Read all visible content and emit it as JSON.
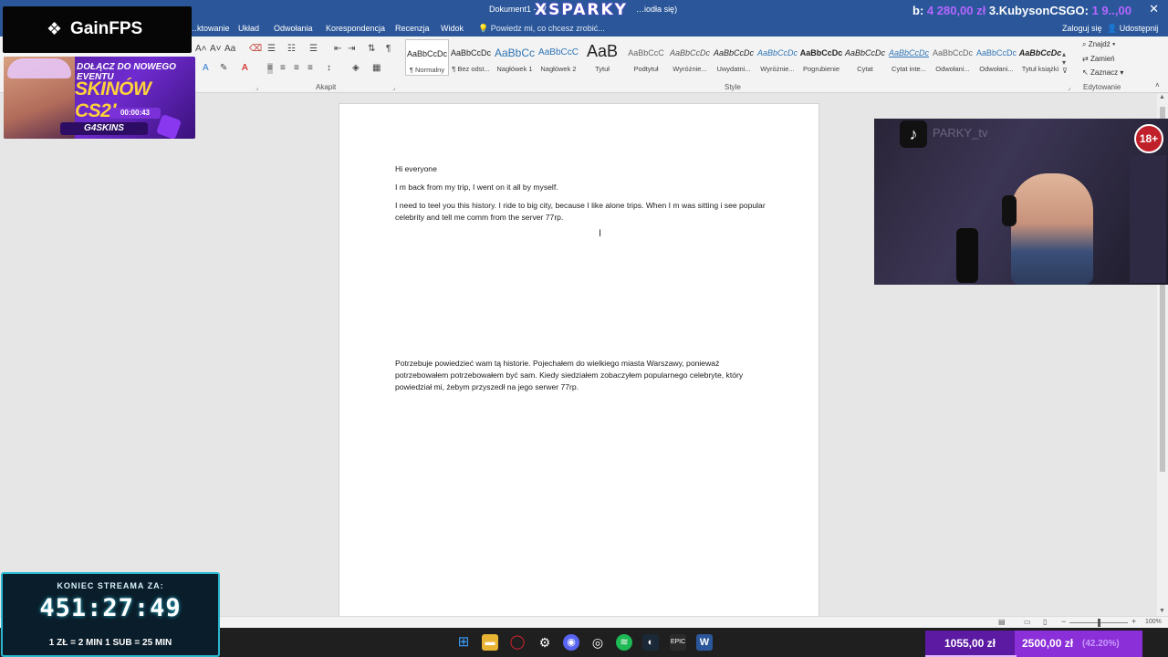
{
  "window": {
    "doc_title": "Dokument1 - W",
    "doc_title_tail": "…iodła się)",
    "watermark": "XSPARKY",
    "close_glyph": "✕"
  },
  "menu": {
    "tabs": [
      "…ktowanie",
      "Układ",
      "Odwołania",
      "Korespondencja",
      "Recenzja",
      "Widok"
    ],
    "tell_me": "Powiedz mi, co chcesz zrobić...",
    "sign_in": "Zaloguj się",
    "share": "Udostępnij"
  },
  "ribbon": {
    "groups": {
      "paragraph": "Akapit",
      "styles": "Style",
      "editing": "Edytowanie"
    },
    "styles_gallery": [
      {
        "sample": "AaBbCcDc",
        "name": "¶ Normalny"
      },
      {
        "sample": "AaBbCcDc",
        "name": "¶ Bez odst..."
      },
      {
        "sample": "AaBbCc",
        "name": "Nagłówek 1"
      },
      {
        "sample": "AaBbCcC",
        "name": "Nagłówek 2"
      },
      {
        "sample": "AaB",
        "name": "Tytuł"
      },
      {
        "sample": "AaBbCcC",
        "name": "Podtytuł"
      },
      {
        "sample": "AaBbCcDc",
        "name": "Wyróżnie..."
      },
      {
        "sample": "AaBbCcDc",
        "name": "Uwydatni..."
      },
      {
        "sample": "AaBbCcDc",
        "name": "Wyróżnie..."
      },
      {
        "sample": "AaBbCcDc",
        "name": "Pogrubienie"
      },
      {
        "sample": "AaBbCcDc",
        "name": "Cytat"
      },
      {
        "sample": "AaBbCcDc",
        "name": "Cytat inte..."
      },
      {
        "sample": "AaBbCcDc",
        "name": "Odwołani..."
      },
      {
        "sample": "AaBbCcDc",
        "name": "Odwołani..."
      },
      {
        "sample": "AaBbCcDc",
        "name": "Tytuł książki"
      }
    ],
    "editing": {
      "find": "Znajdź",
      "replace": "Zamień",
      "select": "Zaznacz"
    }
  },
  "document": {
    "p1": "Hi everyone",
    "p2": "I m back from my trip, I went on it all by myself.",
    "p3": "I need to teel you this history. I ride to big city, because I like alone trips. When I m was sitting i see popular celebrity and tell me comm from the server 77rp.",
    "p4": "Potrzebuje powiedzieć wam tą historie. Pojechałem do wielkiego miasta Warszawy, ponieważ potrzebowałem potrzebowałem być sam.  Kiedy siedziałem zobaczyłem popularnego celebryte, który powiedział mi, żebym przyszedł na jego serwer 77rp."
  },
  "statusbar": {
    "zoom": "100%",
    "zoom_minus": "−",
    "zoom_plus": "+"
  },
  "overlays": {
    "brand": "GainFPS",
    "event_headline": "DOŁĄCZ DO NOWEGO EVENTU",
    "event_big": "SKINÓW CS2!",
    "event_timer": "00:00:43",
    "event_sponsor": "G4SKINS",
    "stats_b_label": "b:",
    "stats_b_value": "4 280,00 zł",
    "stats_user": "3.Kubyson",
    "stats_csgo_label": "CSGO:",
    "stats_csgo_value": "1 9..,00",
    "tiktok_handle": "PARKY_tv",
    "age_badge": "18+",
    "countdown_label": "KONIEC STREAMA ZA:",
    "countdown_time": "451:27:49",
    "countdown_rates": "1 ZŁ = 2 MIN   1 SUB = 25 MIN",
    "donations_current": "1055,00 zł",
    "donations_goal": "2500,00 zł",
    "donations_percent": "(42.20%)",
    "donations_progress": 0.422
  },
  "colors": {
    "word_blue": "#2b579a",
    "accent_purple": "#8b2fd8",
    "countdown_border": "#28b8d0"
  }
}
